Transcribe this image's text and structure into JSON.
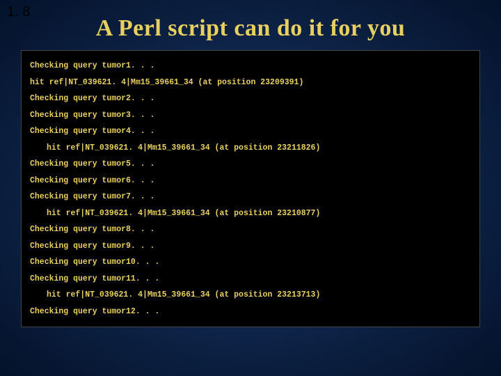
{
  "slide": {
    "number": "1. 8",
    "title": "A Perl script can do it for you"
  },
  "terminal": {
    "lines": [
      {
        "text": "Checking query tumor1. . .",
        "indent": false
      },
      {
        "text": "hit ref|NT_039621. 4|Mm15_39661_34 (at position 23209391)",
        "indent": false
      },
      {
        "text": "Checking query tumor2. . .",
        "indent": false
      },
      {
        "text": "Checking query tumor3. . .",
        "indent": false
      },
      {
        "text": "Checking query tumor4. . .",
        "indent": false
      },
      {
        "text": "hit ref|NT_039621. 4|Mm15_39661_34 (at position 23211826)",
        "indent": true
      },
      {
        "text": "Checking query tumor5. . .",
        "indent": false
      },
      {
        "text": "Checking query tumor6. . .",
        "indent": false
      },
      {
        "text": "Checking query tumor7. . .",
        "indent": false
      },
      {
        "text": "hit ref|NT_039621. 4|Mm15_39661_34 (at position 23210877)",
        "indent": true
      },
      {
        "text": "Checking query tumor8. . .",
        "indent": false
      },
      {
        "text": "Checking query tumor9. . .",
        "indent": false
      },
      {
        "text": "Checking query tumor10. . .",
        "indent": false
      },
      {
        "text": "Checking query tumor11. . .",
        "indent": false
      },
      {
        "text": "hit ref|NT_039621. 4|Mm15_39661_34 (at position 23213713)",
        "indent": true
      },
      {
        "text": "Checking query tumor12. . .",
        "indent": false
      }
    ]
  }
}
